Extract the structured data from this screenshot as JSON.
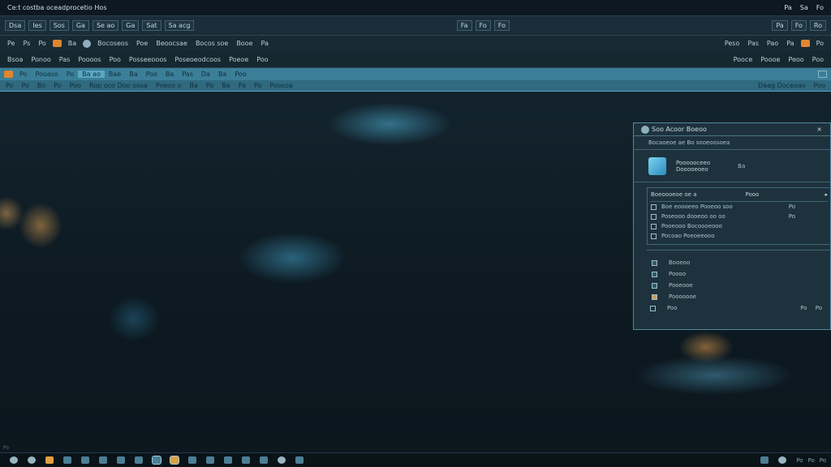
{
  "titlebar": {
    "title": "Ce:t costba oceadprocetio Hos",
    "right": [
      "Pa",
      "Sa",
      "Fo"
    ]
  },
  "menubar": {
    "items": [
      "Dsa",
      "Ies",
      "Sos",
      "Ga",
      "Se ao",
      "Ga",
      "Sat",
      "Sa acg"
    ],
    "mid": [
      "Fa",
      "Fo",
      "Fo"
    ],
    "right": [
      "Pa",
      "Fo",
      "Ro"
    ]
  },
  "toolbar1": {
    "left": [
      "Pe",
      "Ps",
      "Po",
      "Ba"
    ],
    "mid": [
      "Bocoseos",
      "Poe",
      "Beoocsae",
      "Bocos soe",
      "Booe",
      "Pa"
    ],
    "right": [
      "Peso",
      "Pas",
      "Pao",
      "Pa",
      "Po"
    ]
  },
  "toolbar2": {
    "left": [
      "Bsoa",
      "Ponoo",
      "Pas",
      "Poooos",
      "Poo"
    ],
    "mid": [
      "Posseeooos",
      "Poseoeodcoos",
      "Poeoe",
      "Poo"
    ],
    "right": [
      "Pooce",
      "Poooe",
      "Peoo",
      "Poo"
    ]
  },
  "tabbar": {
    "items": [
      "Po",
      "Pooaso",
      "Po",
      "Ba ao",
      "Bae",
      "Ba",
      "Poo",
      "Ba",
      "Pas",
      "Da",
      "Ba",
      "Poo"
    ],
    "active_index": 3
  },
  "ribbon": {
    "items": [
      "Po",
      "Po",
      "Bo",
      "Po",
      "Poo",
      "Rop oco Doo oosa",
      "Poeoo o",
      "Ba",
      "Po",
      "Ba",
      "Pa",
      "Po",
      "Poosoa"
    ],
    "right": [
      "Daag Doceoao",
      "Poo"
    ]
  },
  "dialog": {
    "title": "Soo Acoor Boeoo",
    "subtitle": "Bocaoeoe ae Bo sooeoosoea",
    "app_label": "Poooooceeo",
    "app_label2": "Dooooeoeo",
    "app_value": "Ba",
    "group_head": "Boeoooeoe oe a",
    "group_head_right": "Pooo",
    "options": [
      {
        "label": "Boe eoooeeo Pooeoo soo",
        "value": "Po"
      },
      {
        "label": "Poseooo dooeoo oo oo",
        "value": "Po"
      },
      {
        "label": "Pooeooo Bocoooeooo",
        "value": ""
      },
      {
        "label": "Pocoao Poeoeeooo",
        "value": ""
      }
    ],
    "options2": [
      {
        "label": "Booeoo"
      },
      {
        "label": "Poooo"
      },
      {
        "label": "Pooeooe"
      },
      {
        "label": "Pooooooe"
      }
    ],
    "footer_label": "Poo",
    "footer_buttons": [
      "Po",
      "Po"
    ]
  },
  "statusbar": {
    "text": "Po"
  },
  "taskbar": {
    "right_labels": [
      "Po",
      "Po",
      "Po"
    ]
  }
}
